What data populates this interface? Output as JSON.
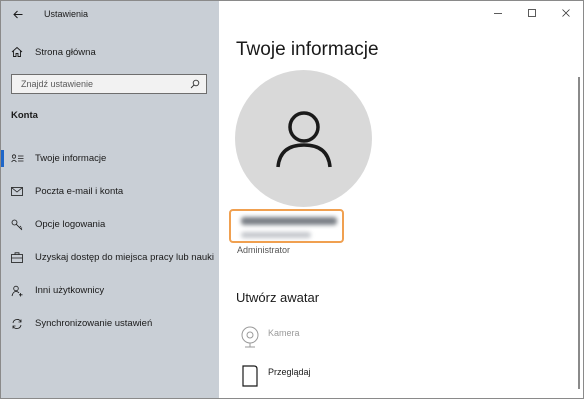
{
  "window": {
    "app_title": "Ustawienia",
    "back_icon": "back-arrow-icon",
    "controls": {
      "minimize": "–",
      "maximize": "☐",
      "close": "✕"
    }
  },
  "sidebar": {
    "home_label": "Strona główna",
    "search_placeholder": "Znajdź ustawienie",
    "section_heading": "Konta",
    "items": [
      {
        "label": "Twoje informacje",
        "icon": "user-card-icon",
        "selected": true
      },
      {
        "label": "Poczta e-mail i konta",
        "icon": "mail-icon",
        "selected": false
      },
      {
        "label": "Opcje logowania",
        "icon": "key-icon",
        "selected": false
      },
      {
        "label": "Uzyskaj dostęp do miejsca pracy lub nauki",
        "icon": "briefcase-icon",
        "selected": false
      },
      {
        "label": "Inni użytkownicy",
        "icon": "person-add-icon",
        "selected": false
      },
      {
        "label": "Synchronizowanie ustawień",
        "icon": "sync-icon",
        "selected": false
      }
    ],
    "colors": {
      "background": "#c9cfd6",
      "accent": "#1e66c8"
    }
  },
  "main": {
    "title": "Twoje informacje",
    "role": "Administrator",
    "create_avatar_title": "Utwórz awatar",
    "camera_label": "Kamera",
    "browse_label": "Przeglądaj",
    "colors": {
      "highlight_border": "#f0a050",
      "avatar_bg": "#d9d9d9"
    }
  }
}
